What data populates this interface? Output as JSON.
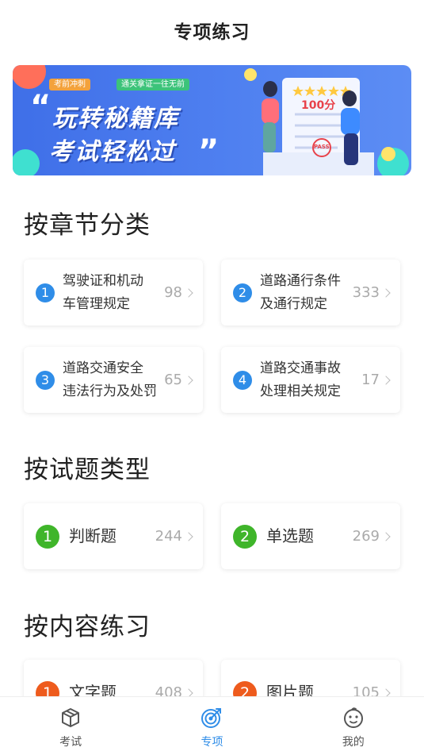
{
  "header": {
    "title": "专项练习"
  },
  "banner": {
    "tag1": "考前冲刺",
    "tag2": "通关拿证一往无前",
    "line1": "玩转秘籍库",
    "line2": "考试轻松过",
    "quote_open": "“",
    "quote_close": "”",
    "score": "100分",
    "stamp": "PASS"
  },
  "sections": {
    "chapter": {
      "title": "按章节分类",
      "items": [
        {
          "index": "1",
          "label_line1": "驾驶证和机动",
          "label_line2": "车管理规定",
          "count": "98"
        },
        {
          "index": "2",
          "label_line1": "道路通行条件",
          "label_line2": "及通行规定",
          "count": "333"
        },
        {
          "index": "3",
          "label_line1": "道路交通安全",
          "label_line2": "违法行为及处罚",
          "count": "65"
        },
        {
          "index": "4",
          "label_line1": "道路交通事故",
          "label_line2": "处理相关规定",
          "count": "17"
        }
      ]
    },
    "type": {
      "title": "按试题类型",
      "items": [
        {
          "index": "1",
          "label": "判断题",
          "count": "244"
        },
        {
          "index": "2",
          "label": "单选题",
          "count": "269"
        }
      ]
    },
    "content": {
      "title": "按内容练习",
      "items": [
        {
          "index": "1",
          "label": "文字题",
          "count": "408"
        },
        {
          "index": "2",
          "label": "图片题",
          "count": "105"
        }
      ]
    }
  },
  "tabbar": {
    "items": [
      {
        "label": "考试",
        "icon": "exam-box-icon"
      },
      {
        "label": "专项",
        "icon": "target-icon"
      },
      {
        "label": "我的",
        "icon": "face-icon"
      }
    ]
  },
  "colors": {
    "chapter_badge": "#2f8de8",
    "type_badge": "#3fb52a",
    "content_badge": "#ee5b1d",
    "tab_active": "#2f8de8"
  }
}
